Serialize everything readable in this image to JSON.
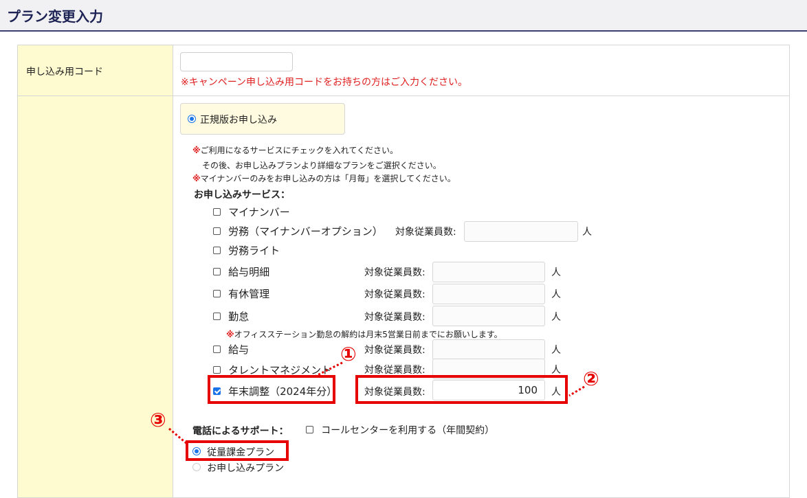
{
  "page": {
    "title": "プラン変更入力"
  },
  "code_row": {
    "label": "申し込み用コード",
    "input_value": "",
    "note": "※キャンペーン申し込み用コードをお持ちの方はご入力ください。"
  },
  "plan_row": {
    "regular_option": "正規版お申し込み",
    "notes": [
      {
        "mark": "※",
        "text": "ご利用になるサービスにチェックを入れてください。"
      },
      {
        "mark": "",
        "text": "その後、お申し込みプランより詳細なプランをご選択ください。"
      },
      {
        "mark": "※",
        "text": "マイナンバーのみをお申し込みの方は「月毎」を選択してください。"
      }
    ],
    "services_heading": "お申し込みサービス：",
    "count_label": "対象従業員数:",
    "unit": "人",
    "services": [
      {
        "label": "マイナンバー",
        "checked": false
      },
      {
        "label": "労務（マイナンバーオプション）",
        "checked": false,
        "count": ""
      },
      {
        "label": "労務ライト",
        "checked": false
      },
      {
        "label": "給与明細",
        "checked": false,
        "count": ""
      },
      {
        "label": "有休管理",
        "checked": false,
        "count": ""
      },
      {
        "label": "勤怠",
        "checked": false,
        "count": ""
      },
      {
        "label": "給与",
        "checked": false,
        "count": ""
      },
      {
        "label": "タレントマネジメント",
        "checked": false,
        "count": ""
      },
      {
        "label": "年末調整（2024年分）",
        "checked": true,
        "count": "100"
      }
    ],
    "attendance_note_mark": "※",
    "attendance_note": "オフィスステーション勤怠の解約は月末5営業日前までにお願いします。",
    "phone_support_label": "電話によるサポート：",
    "call_center_option": "コールセンターを利用する（年間契約）",
    "plan_options": [
      {
        "label": "従量課金プラン",
        "selected": true
      },
      {
        "label": "お申し込みプラン",
        "selected": false
      }
    ]
  },
  "annotations": {
    "one": "①",
    "two": "②",
    "three": "③"
  },
  "colors": {
    "header_text": "#1d2254",
    "label_bg": "#fffbd0",
    "highlight": "#e60000",
    "note_red": "#e02020"
  }
}
